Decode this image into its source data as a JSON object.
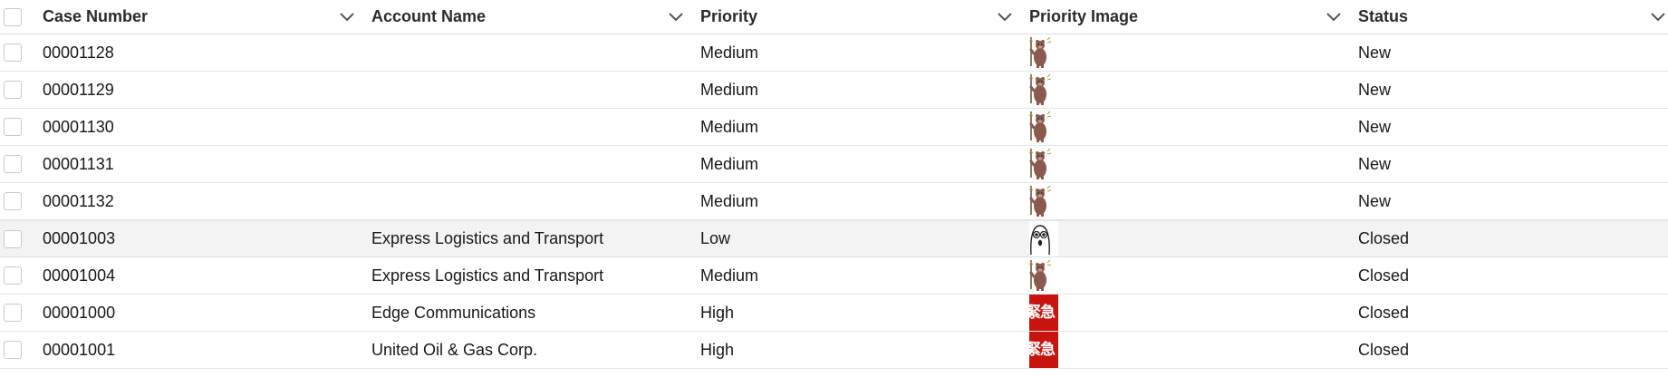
{
  "table": {
    "columns": [
      {
        "label": "Case Number"
      },
      {
        "label": "Account Name"
      },
      {
        "label": "Priority"
      },
      {
        "label": "Priority Image"
      },
      {
        "label": "Status"
      }
    ],
    "rows": [
      {
        "case_number": "00001128",
        "account_name": "",
        "priority": "Medium",
        "priority_image": "bear-flag-icon",
        "status": "New",
        "highlighted": false
      },
      {
        "case_number": "00001129",
        "account_name": "",
        "priority": "Medium",
        "priority_image": "bear-flag-icon",
        "status": "New",
        "highlighted": false
      },
      {
        "case_number": "00001130",
        "account_name": "",
        "priority": "Medium",
        "priority_image": "bear-flag-icon",
        "status": "New",
        "highlighted": false
      },
      {
        "case_number": "00001131",
        "account_name": "",
        "priority": "Medium",
        "priority_image": "bear-flag-icon",
        "status": "New",
        "highlighted": false
      },
      {
        "case_number": "00001132",
        "account_name": "",
        "priority": "Medium",
        "priority_image": "bear-flag-icon",
        "status": "New",
        "highlighted": false
      },
      {
        "case_number": "00001003",
        "account_name": "Express Logistics and Transport",
        "priority": "Low",
        "priority_image": "surprised-face-icon",
        "status": "Closed",
        "highlighted": true
      },
      {
        "case_number": "00001004",
        "account_name": "Express Logistics and Transport",
        "priority": "Medium",
        "priority_image": "bear-flag-icon",
        "status": "Closed",
        "highlighted": false
      },
      {
        "case_number": "00001000",
        "account_name": "Edge Communications",
        "priority": "High",
        "priority_image": "urgent-stamp-icon",
        "status": "Closed",
        "highlighted": false
      },
      {
        "case_number": "00001001",
        "account_name": "United Oil & Gas Corp.",
        "priority": "High",
        "priority_image": "urgent-stamp-icon",
        "status": "Closed",
        "highlighted": false
      }
    ],
    "urgent_stamp_text": "緊急"
  },
  "colors": {
    "urgent_red": "#c8140f",
    "bear_brown": "#8a5a4e",
    "highlight_row": "#f3f3f3"
  }
}
